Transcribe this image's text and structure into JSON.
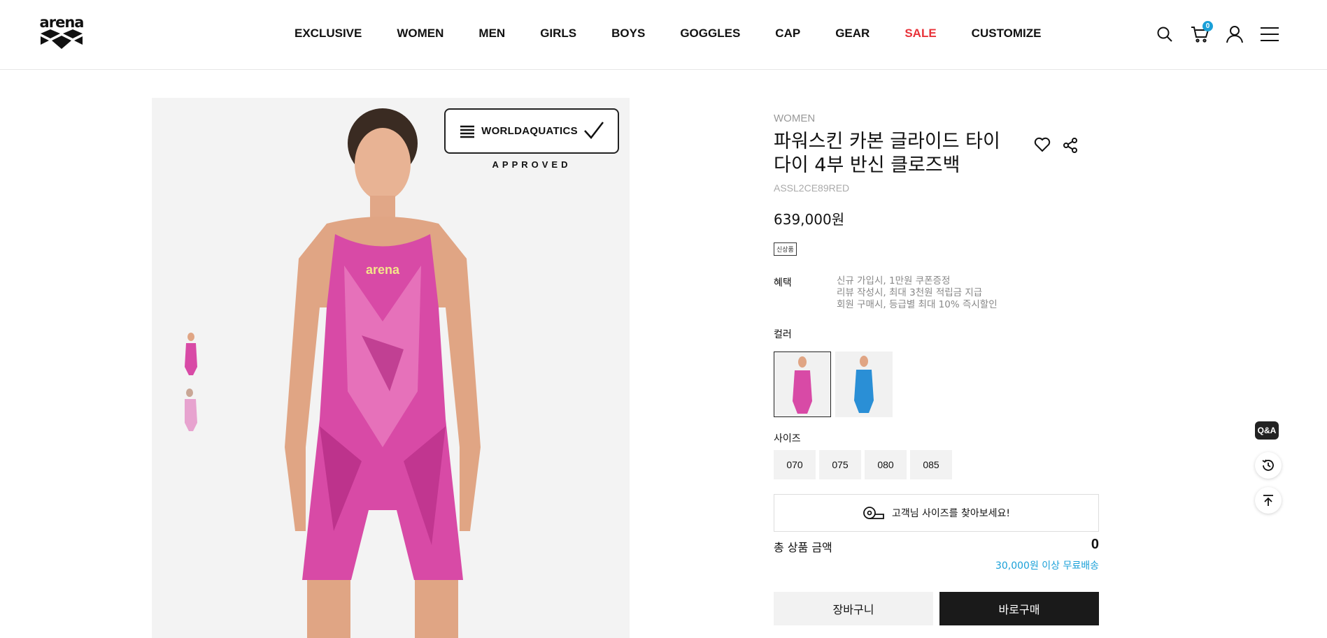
{
  "header": {
    "logo_text": "arena",
    "nav": [
      {
        "label": "EXCLUSIVE"
      },
      {
        "label": "WOMEN"
      },
      {
        "label": "MEN"
      },
      {
        "label": "GIRLS"
      },
      {
        "label": "BOYS"
      },
      {
        "label": "GOGGLES"
      },
      {
        "label": "CAP"
      },
      {
        "label": "GEAR"
      },
      {
        "label": "SALE",
        "accent": "#e8333a"
      },
      {
        "label": "CUSTOMIZE"
      }
    ],
    "icons": [
      "search-icon",
      "cart-icon",
      "user-icon",
      "menu-icon"
    ],
    "cart_count": "0",
    "badge_color": "#1aa0d8"
  },
  "gallery": {
    "badge_text": "WORLDAQUATICS",
    "badge_subtext": "APPROVED",
    "thumbnails": 2
  },
  "product": {
    "category": "WOMEN",
    "title": "파워스킨 카본 글라이드 타이 다이 4부 반신 클로즈백",
    "sku": "ASSL2CE89RED",
    "price": "639,000원",
    "tag": "신상품",
    "benefit_label": "혜택",
    "benefits": [
      "신규 가입시, 1만원 쿠폰증정",
      "리뷰 작성시, 최대 3천원 적립금 지급",
      "회원 구매시, 등급별 최대 10% 즉시할인"
    ],
    "color_label": "컬러",
    "colors": [
      {
        "name": "pink",
        "hex": "#d6449e"
      },
      {
        "name": "blue",
        "hex": "#2a8fd6"
      }
    ],
    "size_label": "사이즈",
    "sizes": [
      "070",
      "075",
      "080",
      "085"
    ],
    "size_finder": "고객님 사이즈를 찾아보세요!",
    "total_label": "총 상품 금액",
    "total_value": "0",
    "shipping_note": "30,000원 이상 무료배송",
    "cart_button": "장바구니",
    "buy_button": "바로구매"
  },
  "floating": {
    "qa_label": "Q&A",
    "icons": [
      "history-icon",
      "scroll-top-icon"
    ]
  }
}
